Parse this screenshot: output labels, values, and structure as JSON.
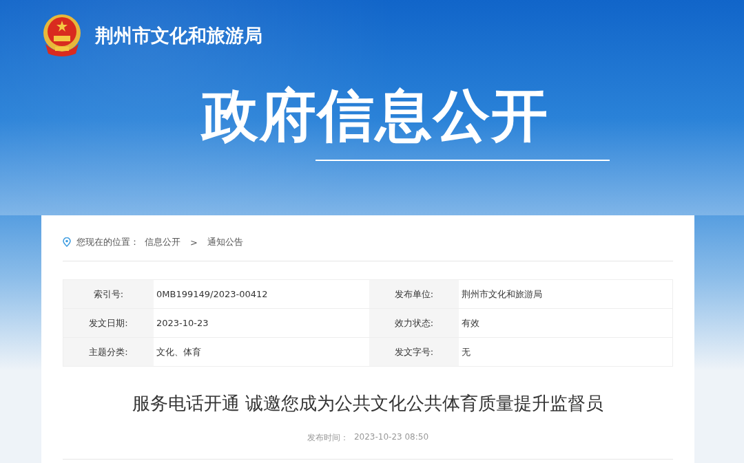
{
  "header": {
    "site_name": "荆州市文化和旅游局",
    "banner_title": "政府信息公开"
  },
  "breadcrumb": {
    "prefix": "您现在的位置：",
    "items": [
      "信息公开",
      "通知公告"
    ],
    "separator": ">"
  },
  "info_table": {
    "rows": [
      [
        {
          "label": "索引号:",
          "value": "0MB199149/2023-00412"
        },
        {
          "label": "发布单位:",
          "value": "荆州市文化和旅游局"
        }
      ],
      [
        {
          "label": "发文日期:",
          "value": "2023-10-23"
        },
        {
          "label": "效力状态:",
          "value": "有效"
        }
      ],
      [
        {
          "label": "主题分类:",
          "value": "文化、体育"
        },
        {
          "label": "发文字号:",
          "value": "无"
        }
      ]
    ]
  },
  "article": {
    "title": "服务电话开通 诚邀您成为公共文化公共体育质量提升监督员",
    "time_label": "发布时间：",
    "time": "2023-10-23 08:50"
  }
}
